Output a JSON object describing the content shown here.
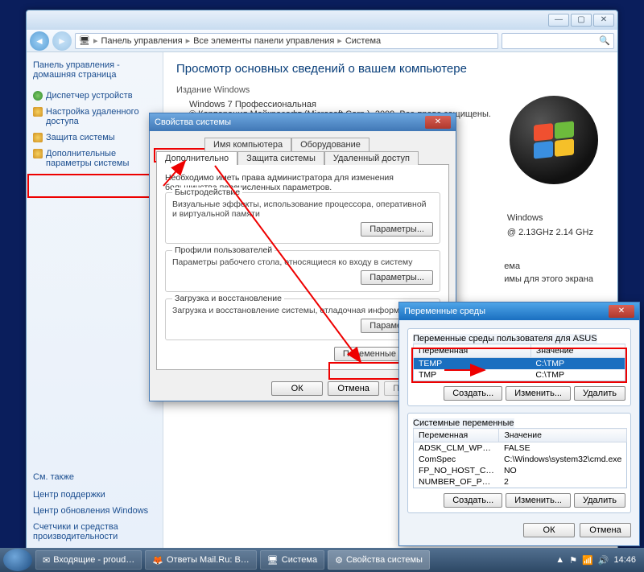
{
  "window": {
    "breadcrumbs": [
      "Панель управления",
      "Все элементы панели управления",
      "Система"
    ],
    "title_btn_min": "—",
    "title_btn_max": "▢",
    "title_btn_close": "✕"
  },
  "sidebar": {
    "title": "Панель управления - домашняя страница",
    "links": [
      {
        "label": "Диспетчер устройств",
        "shield": false
      },
      {
        "label": "Настройка удаленного доступа",
        "shield": true
      },
      {
        "label": "Защита системы",
        "shield": true
      },
      {
        "label": "Дополнительные параметры системы",
        "shield": true
      }
    ],
    "seealso_title": "См. также",
    "seealso": [
      "Центр поддержки",
      "Центр обновления Windows",
      "Счетчики и средства производительности"
    ]
  },
  "main": {
    "heading": "Просмотр основных сведений о вашем компьютере",
    "edition_hdr": "Издание Windows",
    "edition": "Windows 7 Профессиональная",
    "copyright": "© Корпорация Майкрософт (Microsoft Corp.), 2009. Все права защищены.",
    "info_os": "Windows",
    "info_cpu": "@ 2.13GHz  2.14 GHz",
    "info_res1": "ема",
    "info_res2": "имы для этого экрана"
  },
  "sysprops": {
    "title": "Свойства системы",
    "tabs_row1": [
      "Имя компьютера",
      "Оборудование"
    ],
    "tabs_row2": [
      "Дополнительно",
      "Защита системы",
      "Удаленный доступ"
    ],
    "active_tab": "Дополнительно",
    "intro": "Необходимо иметь права администратора для изменения большинства перечисленных параметров.",
    "perf_title": "Быстродействие",
    "perf_desc": "Визуальные эффекты, использование процессора, оперативной и виртуальной памяти",
    "profiles_title": "Профили пользователей",
    "profiles_desc": "Параметры рабочего стола, относящиеся ко входу в систему",
    "startup_title": "Загрузка и восстановление",
    "startup_desc": "Загрузка и восстановление системы, отладочная информация",
    "params_btn": "Параметры...",
    "env_btn": "Переменные среды...",
    "ok": "ОК",
    "cancel": "Отмена",
    "apply": "Применить"
  },
  "envvars": {
    "title": "Переменные среды",
    "user_group": "Переменные среды пользователя для ASUS",
    "col_var": "Переменная",
    "col_val": "Значение",
    "user_rows": [
      {
        "var": "TEMP",
        "val": "C:\\TMP",
        "sel": true
      },
      {
        "var": "TMP",
        "val": "C:\\TMP",
        "sel": false
      }
    ],
    "sys_group": "Системные переменные",
    "sys_rows": [
      {
        "var": "ADSK_CLM_WP…",
        "val": "FALSE"
      },
      {
        "var": "ComSpec",
        "val": "C:\\Windows\\system32\\cmd.exe"
      },
      {
        "var": "FP_NO_HOST_C…",
        "val": "NO"
      },
      {
        "var": "NUMBER_OF_P…",
        "val": "2"
      }
    ],
    "create": "Создать...",
    "edit": "Изменить...",
    "del": "Удалить",
    "ok": "ОК",
    "cancel": "Отмена"
  },
  "taskbar": {
    "items": [
      {
        "label": "Входящие - proud…"
      },
      {
        "label": "Ответы Mail.Ru: В…"
      },
      {
        "label": "Система"
      },
      {
        "label": "Свойства системы"
      }
    ],
    "clock": "14:46"
  }
}
